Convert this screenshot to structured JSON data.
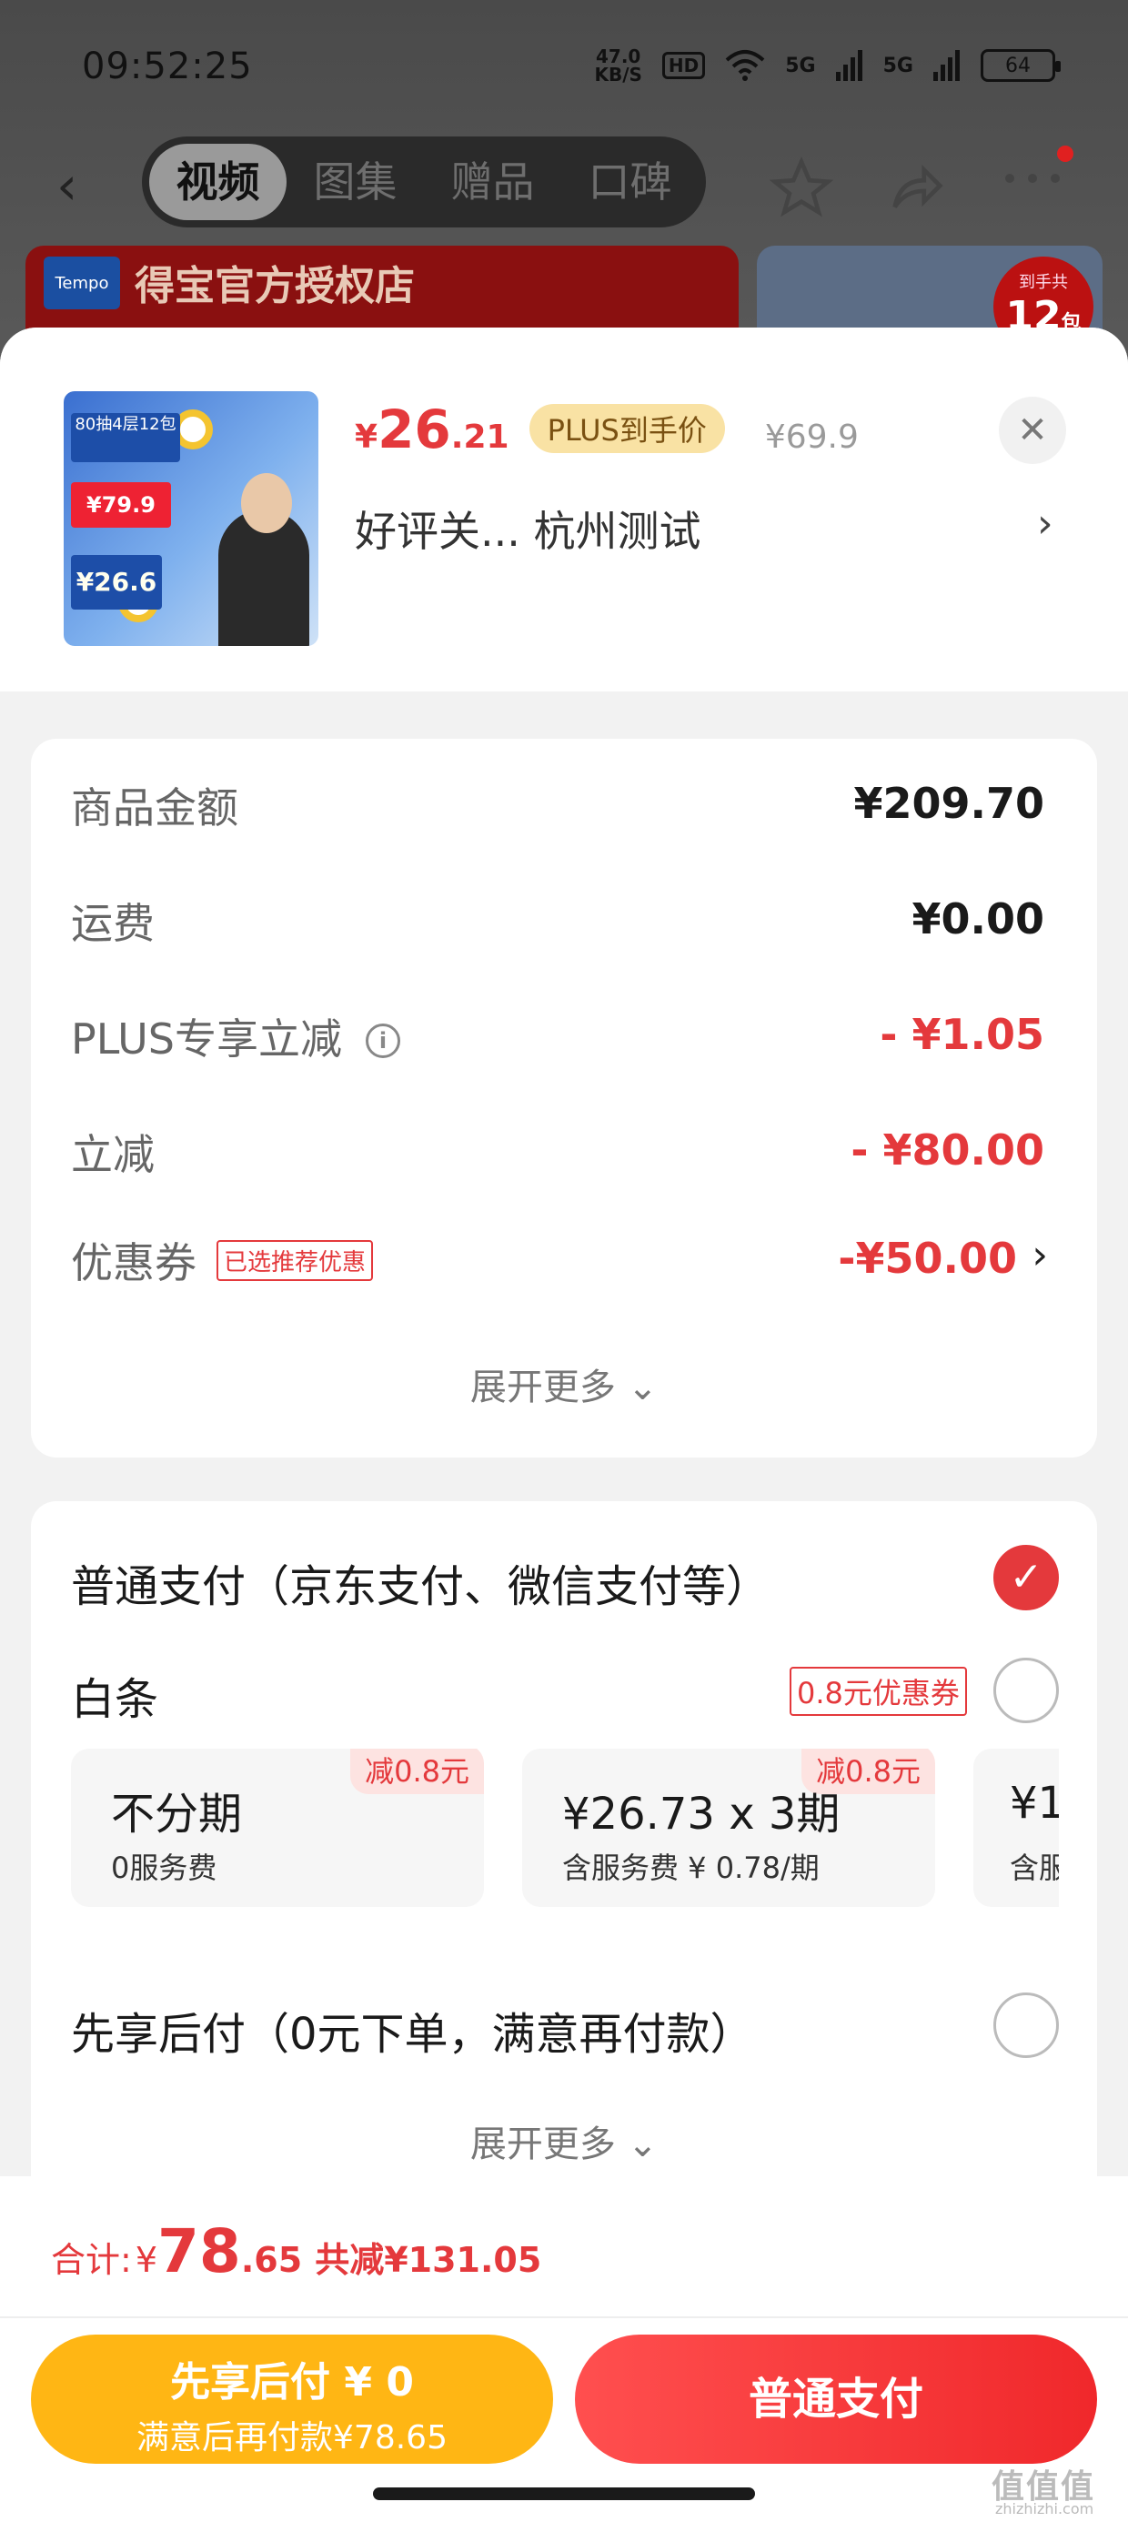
{
  "status": {
    "time": "09:52:25",
    "net_speed": "47.0",
    "net_unit": "KB/S",
    "hd": "HD",
    "signal1": "5G",
    "signal2": "5G",
    "battery": "64"
  },
  "nav": {
    "back_icon": "chevron-left-icon",
    "tabs": [
      "视频",
      "图集",
      "赠品",
      "口碑"
    ],
    "active_tab": "视频",
    "icons": [
      "star-icon",
      "share-icon",
      "more-icon"
    ]
  },
  "banner": {
    "logo": "Tempo",
    "title": "得宝官方授权店",
    "badge_top": "到手共",
    "badge_num": "12",
    "badge_unit": "包"
  },
  "product": {
    "thumb_tag": "80抽4层12包",
    "thumb_promo": "¥79.9",
    "thumb_price": "¥26.6",
    "price_symbol": "¥",
    "price_int": "26",
    "price_dec": ".21",
    "plus_tag": "PLUS到手价",
    "original_price": "¥69.9",
    "spec": "好评关...  杭州测试",
    "close_icon": "✕",
    "chevron": "›"
  },
  "amounts": {
    "rows": [
      {
        "label": "商品金额",
        "value": "¥209.70"
      },
      {
        "label": "运费",
        "value": "¥0.00"
      },
      {
        "label": "PLUS专享立减",
        "value": "- ¥1.05"
      },
      {
        "label": "立减",
        "value": "- ¥80.00"
      },
      {
        "label": "优惠券",
        "value": "-¥50.00"
      }
    ],
    "coupon_tag": "已选推荐优惠",
    "info_icon": "i",
    "expand": "展开更多 ⌄"
  },
  "payment": {
    "normal": "普通支付（京东支付、微信支付等）",
    "baitiao": "白条",
    "baitiao_tag": "0.8元优惠券",
    "plans": [
      {
        "main": "不分期",
        "sub": "0服务费",
        "badge": "减0.8元"
      },
      {
        "main": "¥26.73 x 3期",
        "sub": "含服务费 ¥ 0.78/期",
        "badge": "减0.8元"
      },
      {
        "main": "¥1",
        "sub": "含服",
        "badge": ""
      }
    ],
    "later": "先享后付（0元下单，满意再付款）",
    "expand": "展开更多 ⌄",
    "check": "✓"
  },
  "footer": {
    "total_label": "合计:",
    "total_symbol": "¥",
    "total_int": "78",
    "total_dec": ".65",
    "saved": "共减¥131.05",
    "btn_later_line1": "先享后付 ¥ 0",
    "btn_later_line2": "满意后再付款¥78.65",
    "btn_normal": "普通支付",
    "watermark": "值值值",
    "watermark_sub": "zhizhizhi.com"
  },
  "colors": {
    "accent_red": "#e4393c",
    "gold": "#ffb614",
    "plus_bg": "#f9e2a4"
  }
}
